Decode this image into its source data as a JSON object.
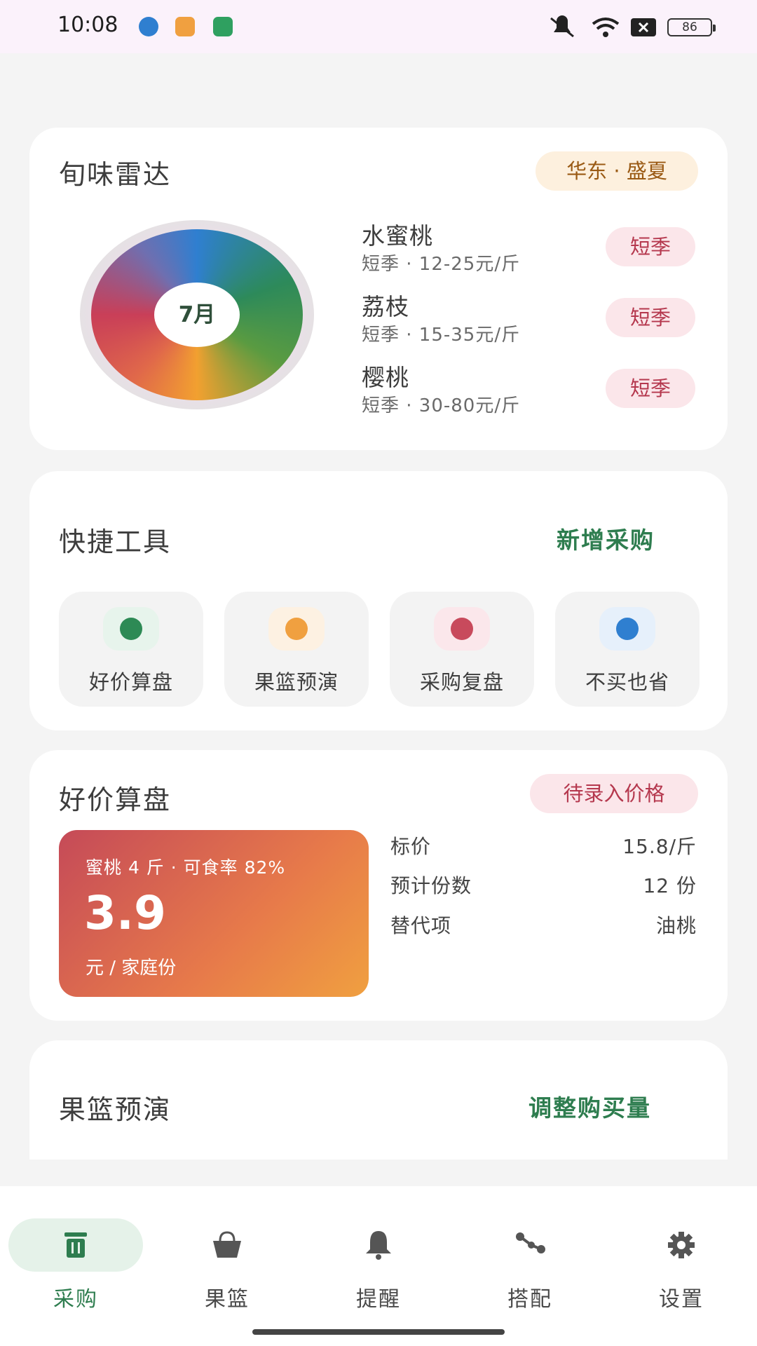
{
  "status_bar": {
    "time": "10:08",
    "battery": "86",
    "app_icons": [
      "#2f7fd0",
      "#f0a040",
      "#2fa060"
    ]
  },
  "radar": {
    "title": "旬味雷达",
    "region_badge": "华东 · 盛夏",
    "month": "7月",
    "fruits": [
      {
        "name": "水蜜桃",
        "meta": "短季 · 12-25元/斤",
        "tag": "短季"
      },
      {
        "name": "荔枝",
        "meta": "短季 · 15-35元/斤",
        "tag": "短季"
      },
      {
        "name": "樱桃",
        "meta": "短季 · 30-80元/斤",
        "tag": "短季"
      }
    ]
  },
  "quick_tools": {
    "title": "快捷工具",
    "action": "新增采购",
    "tools": [
      {
        "label": "好价算盘",
        "dot": "#2d8a55",
        "bg": "#e7f4ec"
      },
      {
        "label": "果篮预演",
        "dot": "#f0a040",
        "bg": "#fdf1e2"
      },
      {
        "label": "采购复盘",
        "dot": "#c84a5c",
        "bg": "#fbe7eb"
      },
      {
        "label": "不买也省",
        "dot": "#2f7fd0",
        "bg": "#e6f0fb"
      }
    ]
  },
  "price_calc": {
    "title": "好价算盘",
    "badge": "待录入价格",
    "subtitle": "蜜桃 4 斤 · 可食率 82%",
    "value": "3.9",
    "unit": "元 / 家庭份",
    "rows": [
      {
        "key": "标价",
        "value": "15.8/斤"
      },
      {
        "key": "预计份数",
        "value": "12 份"
      },
      {
        "key": "替代项",
        "value": "油桃"
      }
    ]
  },
  "basket": {
    "title": "果篮预演",
    "action": "调整购买量"
  },
  "nav": {
    "items": [
      {
        "label": "采购",
        "icon": "trash-bin-icon",
        "active": true
      },
      {
        "label": "果篮",
        "icon": "basket-icon",
        "active": false
      },
      {
        "label": "提醒",
        "icon": "bell-icon",
        "active": false
      },
      {
        "label": "搭配",
        "icon": "share-nodes-icon",
        "active": false
      },
      {
        "label": "设置",
        "icon": "gear-icon",
        "active": false
      }
    ]
  },
  "colors": {
    "accent_green": "#2e7d4f",
    "tag_red": "#b5384e",
    "badge_amber": "#9a5a14"
  }
}
